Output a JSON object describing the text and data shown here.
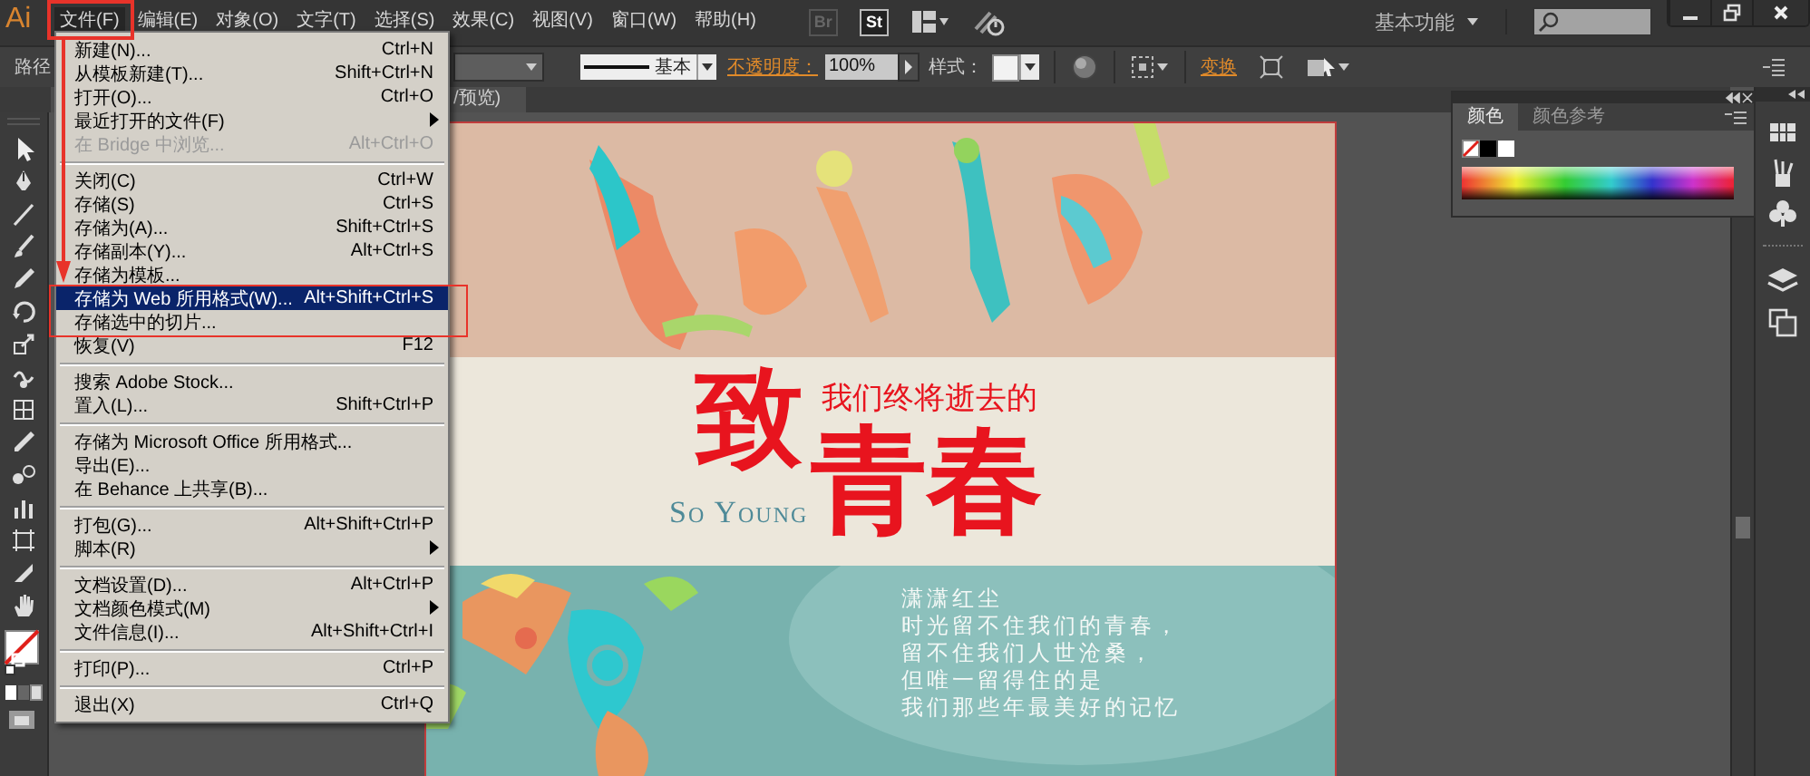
{
  "app": {
    "logo": "Ai",
    "bridge_badge": "Br",
    "stock_badge": "St",
    "workspace": "基本功能"
  },
  "menubar": [
    {
      "label": "文件(F)",
      "selected": true
    },
    {
      "label": "编辑(E)",
      "selected": false
    },
    {
      "label": "对象(O)",
      "selected": false
    },
    {
      "label": "文字(T)",
      "selected": false
    },
    {
      "label": "选择(S)",
      "selected": false
    },
    {
      "label": "效果(C)",
      "selected": false
    },
    {
      "label": "视图(V)",
      "selected": false
    },
    {
      "label": "窗口(W)",
      "selected": false
    },
    {
      "label": "帮助(H)",
      "selected": false
    }
  ],
  "control_bar": {
    "path_label": "路径",
    "stroke_style": "基本",
    "opacity_label": "不透明度：",
    "opacity_value": "100%",
    "style_label": "样式：",
    "transform_label": "变换"
  },
  "document_tab": {
    "title": "/预览)"
  },
  "file_menu": [
    {
      "kind": "item",
      "label": "新建(N)...",
      "shortcut": "Ctrl+N",
      "disabled": false,
      "selected": false
    },
    {
      "kind": "item",
      "label": "从模板新建(T)...",
      "shortcut": "Shift+Ctrl+N",
      "disabled": false,
      "selected": false
    },
    {
      "kind": "item",
      "label": "打开(O)...",
      "shortcut": "Ctrl+O",
      "disabled": false,
      "selected": false
    },
    {
      "kind": "submenu",
      "label": "最近打开的文件(F)",
      "disabled": false,
      "selected": false
    },
    {
      "kind": "item",
      "label": "在 Bridge 中浏览...",
      "shortcut": "Alt+Ctrl+O",
      "disabled": true,
      "selected": false
    },
    {
      "kind": "separator"
    },
    {
      "kind": "item",
      "label": "关闭(C)",
      "shortcut": "Ctrl+W",
      "disabled": false,
      "selected": false
    },
    {
      "kind": "item",
      "label": "存储(S)",
      "shortcut": "Ctrl+S",
      "disabled": false,
      "selected": false
    },
    {
      "kind": "item",
      "label": "存储为(A)...",
      "shortcut": "Shift+Ctrl+S",
      "disabled": false,
      "selected": false
    },
    {
      "kind": "item",
      "label": "存储副本(Y)...",
      "shortcut": "Alt+Ctrl+S",
      "disabled": false,
      "selected": false
    },
    {
      "kind": "item",
      "label": "存储为模板...",
      "disabled": false,
      "selected": false
    },
    {
      "kind": "item",
      "label": "存储为 Web 所用格式(W)...",
      "shortcut": "Alt+Shift+Ctrl+S",
      "disabled": false,
      "selected": true
    },
    {
      "kind": "item",
      "label": "存储选中的切片...",
      "disabled": false,
      "selected": false
    },
    {
      "kind": "item",
      "label": "恢复(V)",
      "shortcut": "F12",
      "disabled": false,
      "selected": false
    },
    {
      "kind": "separator"
    },
    {
      "kind": "item",
      "label": "搜索 Adobe Stock...",
      "disabled": false,
      "selected": false
    },
    {
      "kind": "item",
      "label": "置入(L)...",
      "shortcut": "Shift+Ctrl+P",
      "disabled": false,
      "selected": false
    },
    {
      "kind": "separator"
    },
    {
      "kind": "item",
      "label": "存储为 Microsoft Office 所用格式...",
      "disabled": false,
      "selected": false
    },
    {
      "kind": "item",
      "label": "导出(E)...",
      "disabled": false,
      "selected": false
    },
    {
      "kind": "item",
      "label": "在 Behance 上共享(B)...",
      "disabled": false,
      "selected": false
    },
    {
      "kind": "separator"
    },
    {
      "kind": "item",
      "label": "打包(G)...",
      "shortcut": "Alt+Shift+Ctrl+P",
      "disabled": false,
      "selected": false
    },
    {
      "kind": "submenu",
      "label": "脚本(R)",
      "disabled": false,
      "selected": false
    },
    {
      "kind": "separator"
    },
    {
      "kind": "item",
      "label": "文档设置(D)...",
      "shortcut": "Alt+Ctrl+P",
      "disabled": false,
      "selected": false
    },
    {
      "kind": "submenu",
      "label": "文档颜色模式(M)",
      "disabled": false,
      "selected": false
    },
    {
      "kind": "item",
      "label": "文件信息(I)...",
      "shortcut": "Alt+Shift+Ctrl+I",
      "disabled": false,
      "selected": false
    },
    {
      "kind": "separator"
    },
    {
      "kind": "item",
      "label": "打印(P)...",
      "shortcut": "Ctrl+P",
      "disabled": false,
      "selected": false
    },
    {
      "kind": "separator"
    },
    {
      "kind": "item",
      "label": "退出(X)",
      "shortcut": "Ctrl+Q",
      "disabled": false,
      "selected": false
    }
  ],
  "color_panel": {
    "tabs": [
      {
        "label": "颜色",
        "selected": true
      },
      {
        "label": "颜色参考",
        "selected": false
      }
    ]
  },
  "artwork": {
    "title_first": "致",
    "subtitle": "我们终将逝去的",
    "title_rest": "青春",
    "english": "So Young",
    "poem": [
      "潇潇红尘",
      "时光留不住我们的青春，",
      "留不住我们人世沧桑，",
      "但唯一留得住的是",
      "我们那些年最美好的记忆"
    ]
  }
}
